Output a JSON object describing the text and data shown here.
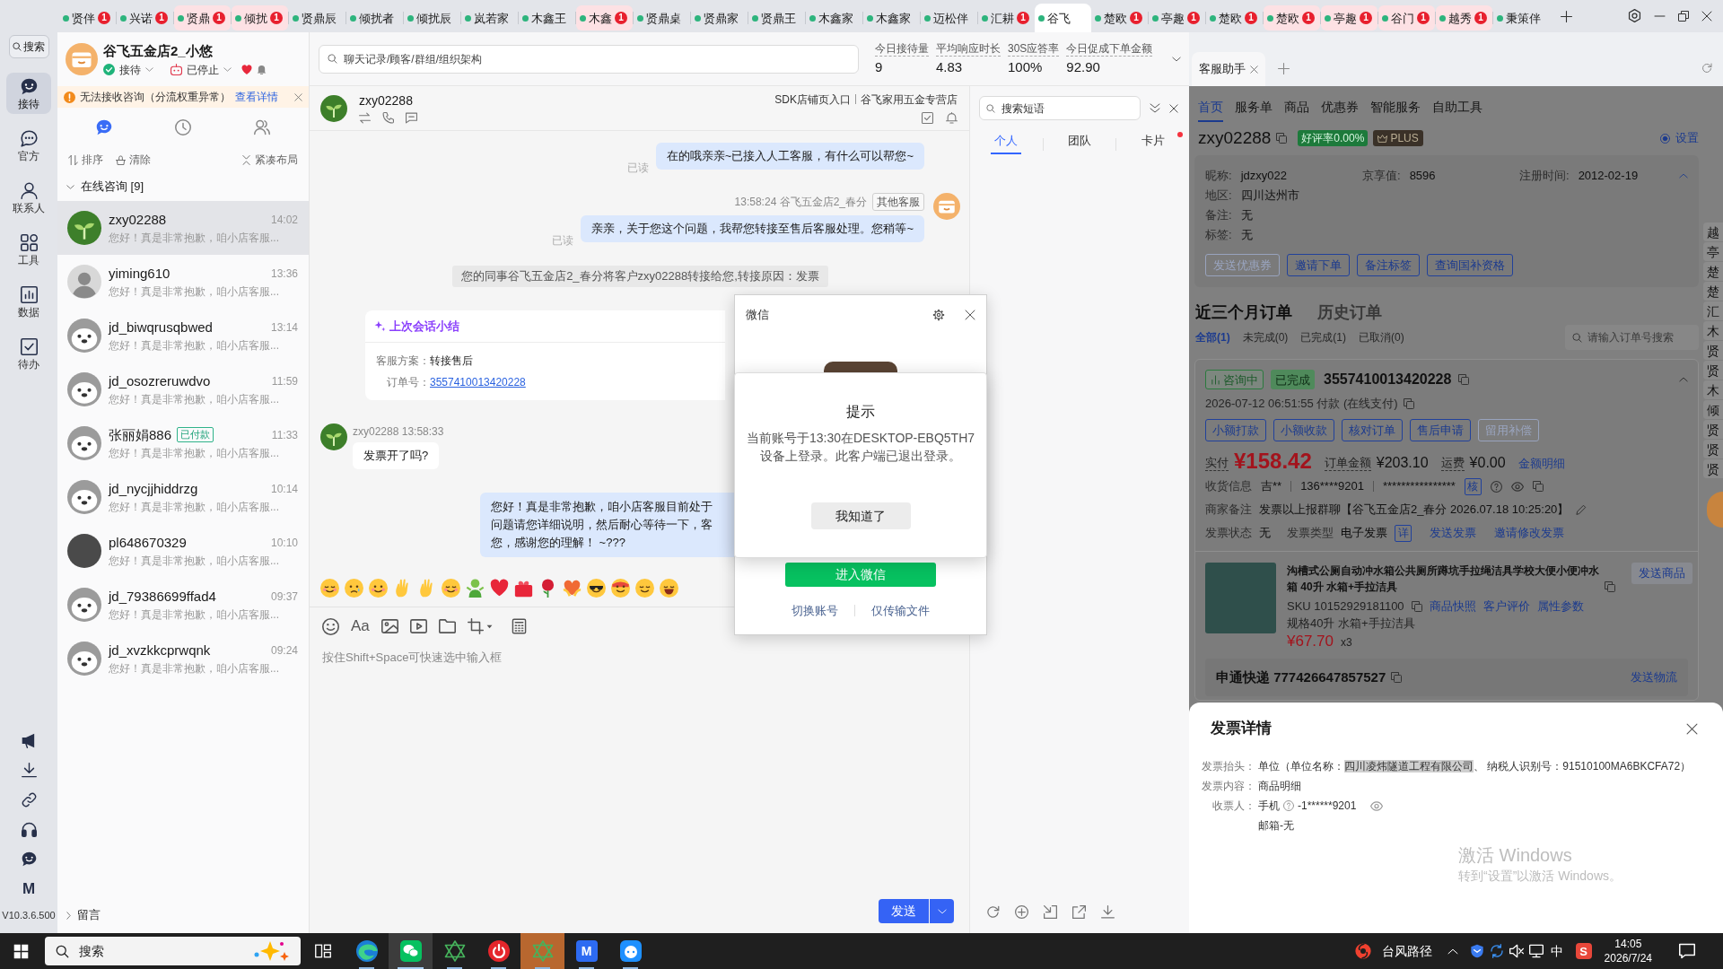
{
  "tab_bar": {
    "tabs": [
      {
        "label": "贤伴",
        "badge": "1",
        "urgent": false,
        "selected": false
      },
      {
        "label": "兴诺",
        "badge": "1",
        "urgent": false,
        "selected": false
      },
      {
        "label": "贤鼎",
        "badge": "1",
        "urgent": true,
        "selected": false
      },
      {
        "label": "倾扰",
        "badge": "1",
        "urgent": true,
        "selected": false
      },
      {
        "label": "贤鼎辰",
        "urgent": false,
        "selected": false
      },
      {
        "label": "倾扰者",
        "urgent": false,
        "selected": false
      },
      {
        "label": "倾扰辰",
        "urgent": false,
        "selected": false
      },
      {
        "label": "岚若家",
        "urgent": false,
        "selected": false
      },
      {
        "label": "木鑫王",
        "urgent": false,
        "selected": false
      },
      {
        "label": "木鑫",
        "badge": "1",
        "urgent": true,
        "selected": false
      },
      {
        "label": "贤鼎桌",
        "urgent": false,
        "selected": false
      },
      {
        "label": "贤鼎家",
        "urgent": false,
        "selected": false
      },
      {
        "label": "贤鼎王",
        "urgent": false,
        "selected": false
      },
      {
        "label": "木鑫家",
        "urgent": false,
        "selected": false
      },
      {
        "label": "木鑫家",
        "urgent": false,
        "selected": false
      },
      {
        "label": "迈松伴",
        "urgent": false,
        "selected": false
      },
      {
        "label": "汇耕",
        "badge": "1",
        "urgent": false,
        "selected": false
      },
      {
        "label": "谷飞",
        "urgent": false,
        "selected": true
      },
      {
        "label": "楚欧",
        "badge": "1",
        "urgent": false,
        "selected": false
      },
      {
        "label": "亭趣",
        "badge": "1",
        "urgent": false,
        "selected": false
      },
      {
        "label": "楚欧",
        "badge": "1",
        "urgent": false,
        "selected": false
      },
      {
        "label": "楚欧",
        "badge": "1",
        "urgent": true,
        "selected": false
      },
      {
        "label": "亭趣",
        "badge": "1",
        "urgent": true,
        "selected": false
      },
      {
        "label": "谷门",
        "badge": "1",
        "urgent": true,
        "selected": false
      },
      {
        "label": "越秀",
        "badge": "1",
        "urgent": true,
        "selected": false
      },
      {
        "label": "秉策伴",
        "urgent": false,
        "selected": false
      }
    ]
  },
  "nav": {
    "search": "搜索",
    "items": [
      {
        "label": "接待",
        "kind": "reception",
        "selected": true
      },
      {
        "label": "官方",
        "kind": "official",
        "selected": false
      },
      {
        "label": "联系人",
        "kind": "contacts",
        "selected": false
      },
      {
        "label": "工具",
        "kind": "tools",
        "selected": false
      },
      {
        "label": "数据",
        "kind": "data",
        "selected": false
      },
      {
        "label": "待办",
        "kind": "todo",
        "selected": false
      }
    ],
    "letter_button": "M",
    "version": "V10.3.6.500"
  },
  "store": {
    "name": "谷飞五金店2_小悠",
    "reception_status": "接待",
    "robot_status": "已停止"
  },
  "warning": {
    "text": "无法接收咨询（分流权重异常）",
    "link": "查看详情"
  },
  "list_tabs": [
    {
      "kind": "chats",
      "selected": true
    },
    {
      "kind": "history",
      "selected": false
    },
    {
      "kind": "contacts",
      "selected": false
    }
  ],
  "list_tools": [
    {
      "label": "排序",
      "kind": "sort"
    },
    {
      "label": "清除",
      "kind": "clear"
    },
    {
      "label": "紧凑布局",
      "kind": "compact"
    }
  ],
  "groups": [
    {
      "title": "在线咨询 [9]",
      "expanded": true,
      "conversations": [
        {
          "name": "zxy02288",
          "time": "14:02",
          "preview": "您好！真是非常抱歉，咱小店客服...",
          "kind": "plant",
          "selected": true
        },
        {
          "name": "yiming610",
          "time": "13:36",
          "preview": "您好！真是非常抱歉，咱小店客服...",
          "kind": "cartoon",
          "selected": false
        },
        {
          "name": "jd_biwqrusqbwed",
          "time": "13:14",
          "preview": "您好！真是非常抱歉，咱小店客服...",
          "kind": "mascot",
          "selected": false
        },
        {
          "name": "jd_osozreruwdvo",
          "time": "11:59",
          "preview": "您好！真是非常抱歉，咱小店客服...",
          "kind": "mascot",
          "selected": false
        },
        {
          "name": "张丽娟886",
          "tag": "已付款",
          "time": "11:33",
          "preview": "您好！真是非常抱歉，咱小店客服...",
          "kind": "mascot",
          "selected": false
        },
        {
          "name": "jd_nycjjhiddrzg",
          "time": "10:14",
          "preview": "您好！真是非常抱歉，咱小店客服...",
          "kind": "mascot",
          "selected": false
        },
        {
          "name": "pl648670329",
          "time": "10:10",
          "preview": "您好！真是非常抱歉，咱小店客服...",
          "kind": "photo",
          "selected": false
        },
        {
          "name": "jd_79386699ffad4",
          "time": "09:37",
          "preview": "您好！真是非常抱歉，咱小店客服...",
          "kind": "mascot",
          "selected": false
        },
        {
          "name": "jd_xvzkkcprwqnk",
          "time": "09:24",
          "preview": "您好！真是非常抱歉，咱小店客服...",
          "kind": "mascot",
          "selected": false
        }
      ]
    },
    {
      "title": "留言",
      "expanded": false
    }
  ],
  "top_search": {
    "placeholder": "聊天记录/顾客/群组/组织架构"
  },
  "stats": [
    {
      "label": "今日接待量",
      "value": "9"
    },
    {
      "label": "平均响应时长",
      "value": "4.83"
    },
    {
      "label": "30S应答率",
      "value": "100%"
    },
    {
      "label": "今日促成下单金额",
      "value": "92.90"
    }
  ],
  "chat": {
    "customer": "zxy02288",
    "shop_entry": "SDK店铺页入口",
    "shop_name": "谷飞家用五金专营店",
    "messages": [
      {
        "kind": "agent",
        "avatar": false,
        "text": "在的哦亲亲~已接入人工客服，有什么可以帮您~",
        "read": "已读"
      },
      {
        "kind": "agent",
        "avatar": true,
        "time": "13:58:24",
        "agent": "谷飞五金店2_春分",
        "agent_tag": "其他客服",
        "text": "亲亲，关于您这个问题，我帮您转接至售后客服处理。您稍等~",
        "read": "已读"
      },
      {
        "kind": "system",
        "text": "您的同事谷飞五金店2_春分将客户zxy02288转接给您,转接原因：发票"
      },
      {
        "kind": "summary",
        "title": "上次会话小结",
        "rows": [
          {
            "label": "客服方案：",
            "value": "转接售后",
            "link": false
          },
          {
            "label": "订单号：",
            "value": "3557410013420228",
            "link": true
          }
        ]
      },
      {
        "kind": "customer",
        "sender": "zxy02288",
        "time": "13:58:33",
        "text": "发票开了吗?"
      },
      {
        "kind": "agent_covered",
        "lines": [
          "您好！真是非常抱歉，咱小店客服目前处于",
          "问题请您详细说明，然后耐心等待一下，客",
          "您，感谢您的理解！ ~???"
        ]
      }
    ],
    "format_button": "Aa",
    "input_placeholder": "按住Shift+Space可快速选中输入框",
    "send": "发送"
  },
  "wechat_dialog": {
    "title": "微信",
    "enter": "进入微信",
    "links": [
      "切换账号",
      "仅传输文件"
    ],
    "prompt": {
      "title": "提示",
      "message": "当前账号于13:30在DESKTOP-EBQ5TH7设备上登录。此客户端已退出登录。",
      "button": "我知道了"
    }
  },
  "quick_phrases": {
    "placeholder": "搜索短语",
    "tabs": [
      {
        "label": "个人",
        "selected": true,
        "new": false
      },
      {
        "label": "团队",
        "selected": false,
        "new": false
      },
      {
        "label": "卡片",
        "selected": false,
        "new": true
      }
    ]
  },
  "assistant_tabs": [
    {
      "label": "客服助手",
      "selected": true
    }
  ],
  "customer_panel": {
    "nav": [
      {
        "label": "首页",
        "selected": true
      },
      {
        "label": "服务单",
        "selected": false
      },
      {
        "label": "商品",
        "selected": false
      },
      {
        "label": "优惠券",
        "selected": false
      },
      {
        "label": "智能服务",
        "selected": false
      },
      {
        "label": "自助工具",
        "selected": false
      }
    ],
    "user_id": "zxy02288",
    "rating": "好评率0.00%",
    "membership": "PLUS",
    "settings": "设置",
    "info": [
      [
        {
          "label": "昵称:",
          "value": "jdzxy022"
        },
        {
          "label": "京享值:",
          "value": "8596"
        },
        {
          "label": "注册时间:",
          "value": "2012-02-19"
        }
      ],
      [
        {
          "label": "地区:",
          "value": "四川达州市"
        }
      ],
      [
        {
          "label": "备注:",
          "value": "无"
        }
      ],
      [
        {
          "label": "标签:",
          "value": "无"
        }
      ]
    ],
    "actions": [
      {
        "label": "发送优惠券",
        "disabled": true
      },
      {
        "label": "邀请下单",
        "disabled": false
      },
      {
        "label": "备注标签",
        "disabled": false
      },
      {
        "label": "查询国补资格",
        "disabled": false
      }
    ],
    "order_tabs": [
      {
        "label": "近三个月订单",
        "selected": true
      },
      {
        "label": "历史订单",
        "selected": false
      }
    ],
    "filters": [
      {
        "label": "全部(1)",
        "selected": true
      },
      {
        "label": "未完成(0)",
        "selected": false
      },
      {
        "label": "已完成(1)",
        "selected": false
      },
      {
        "label": "已取消(0)",
        "selected": false
      }
    ],
    "order_search": {
      "placeholder": "请输入订单号搜索"
    },
    "order": {
      "tags": [
        {
          "label": "咨询中",
          "kind": "consulting"
        },
        {
          "label": "已完成",
          "kind": "completed"
        }
      ],
      "number": "3557410013420228",
      "paid": "2026-07-12 06:51:55 付款 (在线支付)",
      "actions": [
        {
          "label": "小额打款",
          "disabled": false
        },
        {
          "label": "小额收款",
          "disabled": false
        },
        {
          "label": "核对订单",
          "disabled": false
        },
        {
          "label": "售后申请",
          "disabled": false
        },
        {
          "label": "留用补偿",
          "disabled": true
        }
      ],
      "amounts": [
        {
          "label": "实付",
          "value": "¥158.42",
          "kind": "paid"
        },
        {
          "label": "订单金额",
          "value": "¥203.10",
          "kind": "total"
        },
        {
          "label": "运费",
          "value": "¥0.00",
          "kind": "freight"
        }
      ],
      "amount_detail": "金额明细",
      "consignee": {
        "label": "收货信息",
        "name": "吉**",
        "phone": "136****9201",
        "address": "****************",
        "verify": "核"
      },
      "remark": {
        "label": "商家备注",
        "text": "发票以上报群聊【谷飞五金店2_春分 2026.07.18 10:25:20】"
      },
      "invoice": {
        "fields": [
          {
            "label": "发票状态",
            "value": "无"
          },
          {
            "label": "发票类型",
            "value": "电子发票"
          }
        ],
        "detail": "详",
        "links": [
          "发送发票",
          "邀请修改发票"
        ]
      },
      "product": {
        "title": "沟槽式公厕自动冲水箱公共厕所蹲坑手拉绳洁具学校大便小便冲水箱 40升 水箱+手拉洁具",
        "sku": "SKU 10152929181100",
        "links": [
          "商品快照",
          "客户评价",
          "属性参数"
        ],
        "spec": "规格40升 水箱+手拉洁具",
        "price": "¥67.70",
        "qty": "x3",
        "send": "发送商品"
      },
      "logistics": {
        "text": "申通快递 777426647857527",
        "send": "发送物流"
      }
    },
    "side_tabs": [
      "越",
      "亭",
      "楚",
      "楚",
      "汇",
      "木",
      "贤",
      "贤",
      "木",
      "倾",
      "贤",
      "贤",
      "贤"
    ]
  },
  "invoice_drawer": {
    "title": "发票详情",
    "rows": [
      {
        "kind": "header",
        "label": "发票抬头：",
        "before": "单位（单位名称：",
        "selected_text": "四川凌炜隧道工程有限公司",
        "after": "、 纳税人识别号：91510100MA6BKCFA72）"
      },
      {
        "kind": "text",
        "label": "发票内容：",
        "value": "商品明细"
      },
      {
        "kind": "recipient",
        "label": "收票人：",
        "phone_label": "手机",
        "phone": "-1******9201",
        "email": "邮箱-无"
      }
    ]
  },
  "os_notice": {
    "title": "激活 Windows",
    "subtitle": "转到“设置”以激活 Windows。"
  },
  "taskbar": {
    "search": {
      "placeholder": "搜索"
    },
    "apps": [
      {
        "kind": "taskview",
        "running": false,
        "active": false,
        "flashing": false
      },
      {
        "kind": "browser",
        "running": true,
        "active": false,
        "flashing": false
      },
      {
        "kind": "chat",
        "running": true,
        "active": true,
        "flashing": false
      },
      {
        "kind": "hexagram",
        "running": true,
        "active": false,
        "flashing": false
      },
      {
        "kind": "record",
        "running": true,
        "active": false,
        "flashing": false
      },
      {
        "kind": "hexagram",
        "running": true,
        "active": false,
        "flashing": true
      },
      {
        "kind": "letter",
        "label": "M",
        "running": true,
        "active": false,
        "flashing": false
      },
      {
        "kind": "bot",
        "running": true,
        "active": false,
        "flashing": false
      }
    ],
    "weather": "台风路径",
    "ime": "中",
    "ime_app": "S",
    "time": "14:05",
    "date": "2026/7/24"
  }
}
